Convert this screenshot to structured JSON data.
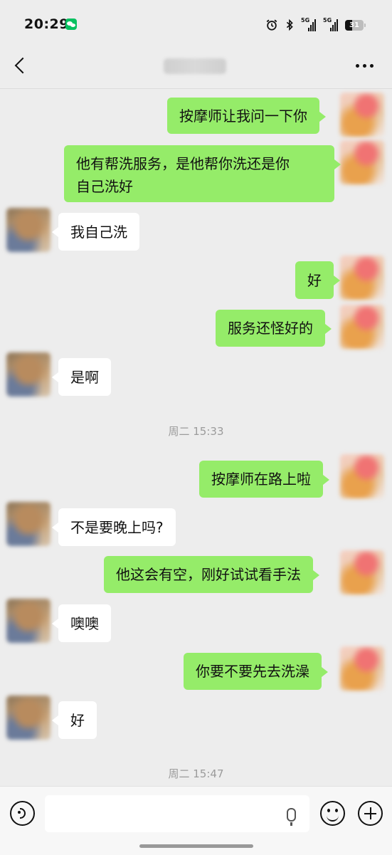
{
  "status_bar": {
    "time": "20:29",
    "network_1": "5G",
    "network_2": "5G",
    "battery": "31",
    "icons": [
      "wechat-icon",
      "alarm-icon",
      "bluetooth-icon",
      "signal-icon",
      "battery-icon"
    ]
  },
  "nav": {
    "back_icon": "chevron-left-icon",
    "more_icon": "more-icon"
  },
  "messages": [
    {
      "sender": "me",
      "text": "按摩师让我问一下你"
    },
    {
      "sender": "me",
      "text": "他有帮洗服务，是他帮你洗还是你\n自己洗好"
    },
    {
      "sender": "other",
      "text": "我自己洗"
    },
    {
      "sender": "me",
      "text": "好"
    },
    {
      "sender": "me",
      "text": "服务还怪好的"
    },
    {
      "sender": "other",
      "text": "是啊"
    },
    {
      "timestamp": "周二 15:33"
    },
    {
      "sender": "me",
      "text": "按摩师在路上啦"
    },
    {
      "sender": "other",
      "text": "不是要晚上吗?"
    },
    {
      "sender": "me",
      "text": "他这会有空，刚好试试看手法"
    },
    {
      "sender": "other",
      "text": "噢噢"
    },
    {
      "sender": "me",
      "text": "你要不要先去洗澡"
    },
    {
      "sender": "other",
      "text": "好"
    },
    {
      "timestamp": "周二 15:47"
    }
  ],
  "input_bar": {
    "input_value": "",
    "icons": [
      "voice-icon",
      "mic-icon",
      "emoji-icon",
      "plus-icon"
    ]
  }
}
